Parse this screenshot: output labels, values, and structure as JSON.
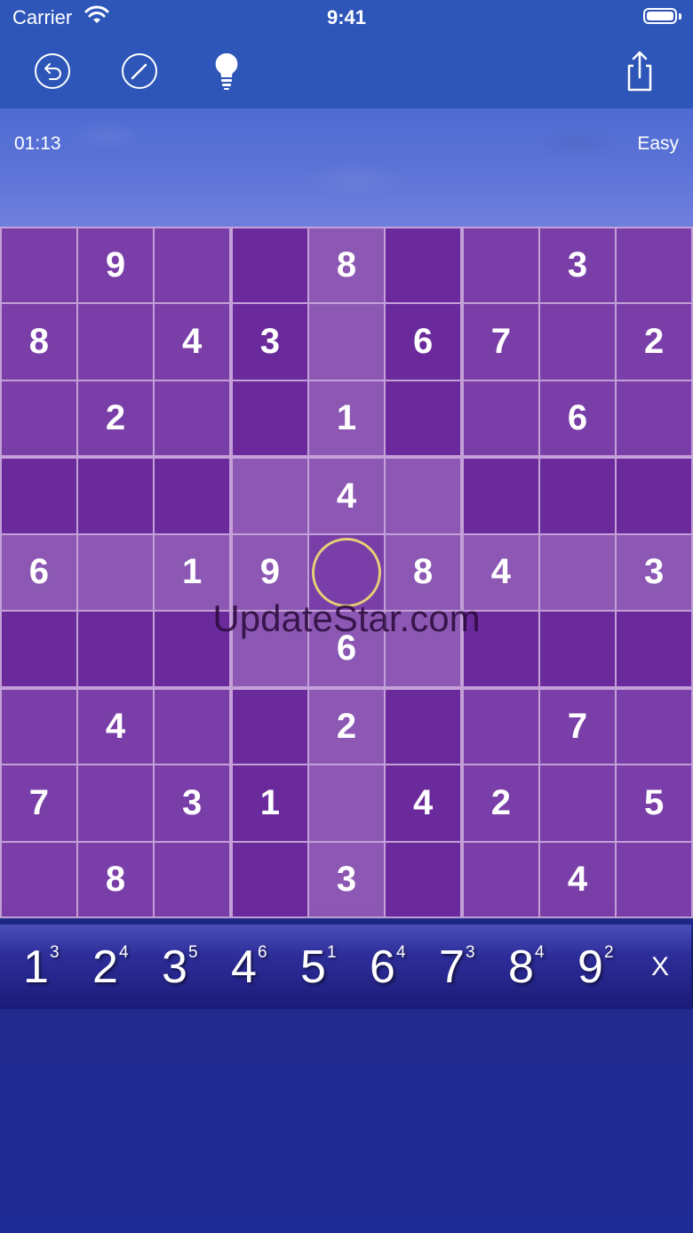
{
  "status_bar": {
    "carrier": "Carrier",
    "time": "9:41"
  },
  "toolbar": {
    "undo_icon": "undo-icon",
    "pencil_icon": "pencil-icon",
    "hint_icon": "lightbulb-icon",
    "share_icon": "share-icon"
  },
  "game": {
    "timer": "01:13",
    "difficulty": "Easy"
  },
  "board": {
    "grid": [
      [
        "",
        "9",
        "",
        "",
        "8",
        "",
        "",
        "3",
        ""
      ],
      [
        "8",
        "",
        "4",
        "3",
        "",
        "6",
        "7",
        "",
        "2"
      ],
      [
        "",
        "2",
        "",
        "",
        "1",
        "",
        "",
        "6",
        ""
      ],
      [
        "",
        "",
        "",
        "",
        "4",
        "",
        "",
        "",
        ""
      ],
      [
        "6",
        "",
        "1",
        "9",
        "",
        "8",
        "4",
        "",
        "3"
      ],
      [
        "",
        "",
        "",
        "",
        "6",
        "",
        "",
        "",
        ""
      ],
      [
        "",
        "4",
        "",
        "",
        "2",
        "",
        "",
        "7",
        ""
      ],
      [
        "7",
        "",
        "3",
        "1",
        "",
        "4",
        "2",
        "",
        "5"
      ],
      [
        "",
        "8",
        "",
        "",
        "3",
        "",
        "",
        "4",
        ""
      ]
    ],
    "selected": {
      "row": 4,
      "col": 4
    },
    "highlighted_cells": [
      [
        0,
        4
      ],
      [
        1,
        4
      ],
      [
        2,
        4
      ],
      [
        3,
        3
      ],
      [
        3,
        4
      ],
      [
        3,
        5
      ],
      [
        4,
        0
      ],
      [
        4,
        1
      ],
      [
        4,
        2
      ],
      [
        4,
        3
      ],
      [
        4,
        5
      ],
      [
        4,
        6
      ],
      [
        4,
        7
      ],
      [
        4,
        8
      ],
      [
        5,
        3
      ],
      [
        5,
        4
      ],
      [
        5,
        5
      ],
      [
        6,
        4
      ],
      [
        7,
        4
      ],
      [
        8,
        4
      ]
    ],
    "watermark": "UpdateStar.com"
  },
  "numpad": {
    "keys": [
      {
        "digit": "1",
        "remaining": "3"
      },
      {
        "digit": "2",
        "remaining": "4"
      },
      {
        "digit": "3",
        "remaining": "5"
      },
      {
        "digit": "4",
        "remaining": "6"
      },
      {
        "digit": "5",
        "remaining": "1"
      },
      {
        "digit": "6",
        "remaining": "4"
      },
      {
        "digit": "7",
        "remaining": "3"
      },
      {
        "digit": "8",
        "remaining": "4"
      },
      {
        "digit": "9",
        "remaining": "2"
      }
    ],
    "clear_label": "X"
  },
  "colors": {
    "header": "#2d56b8",
    "cell_light": "#7a3ea8",
    "cell_dark": "#6a2a9c",
    "cell_highlight": "#8c58b4",
    "grid_line": "#c4a0d8",
    "selection_ring": "#e3d077"
  }
}
